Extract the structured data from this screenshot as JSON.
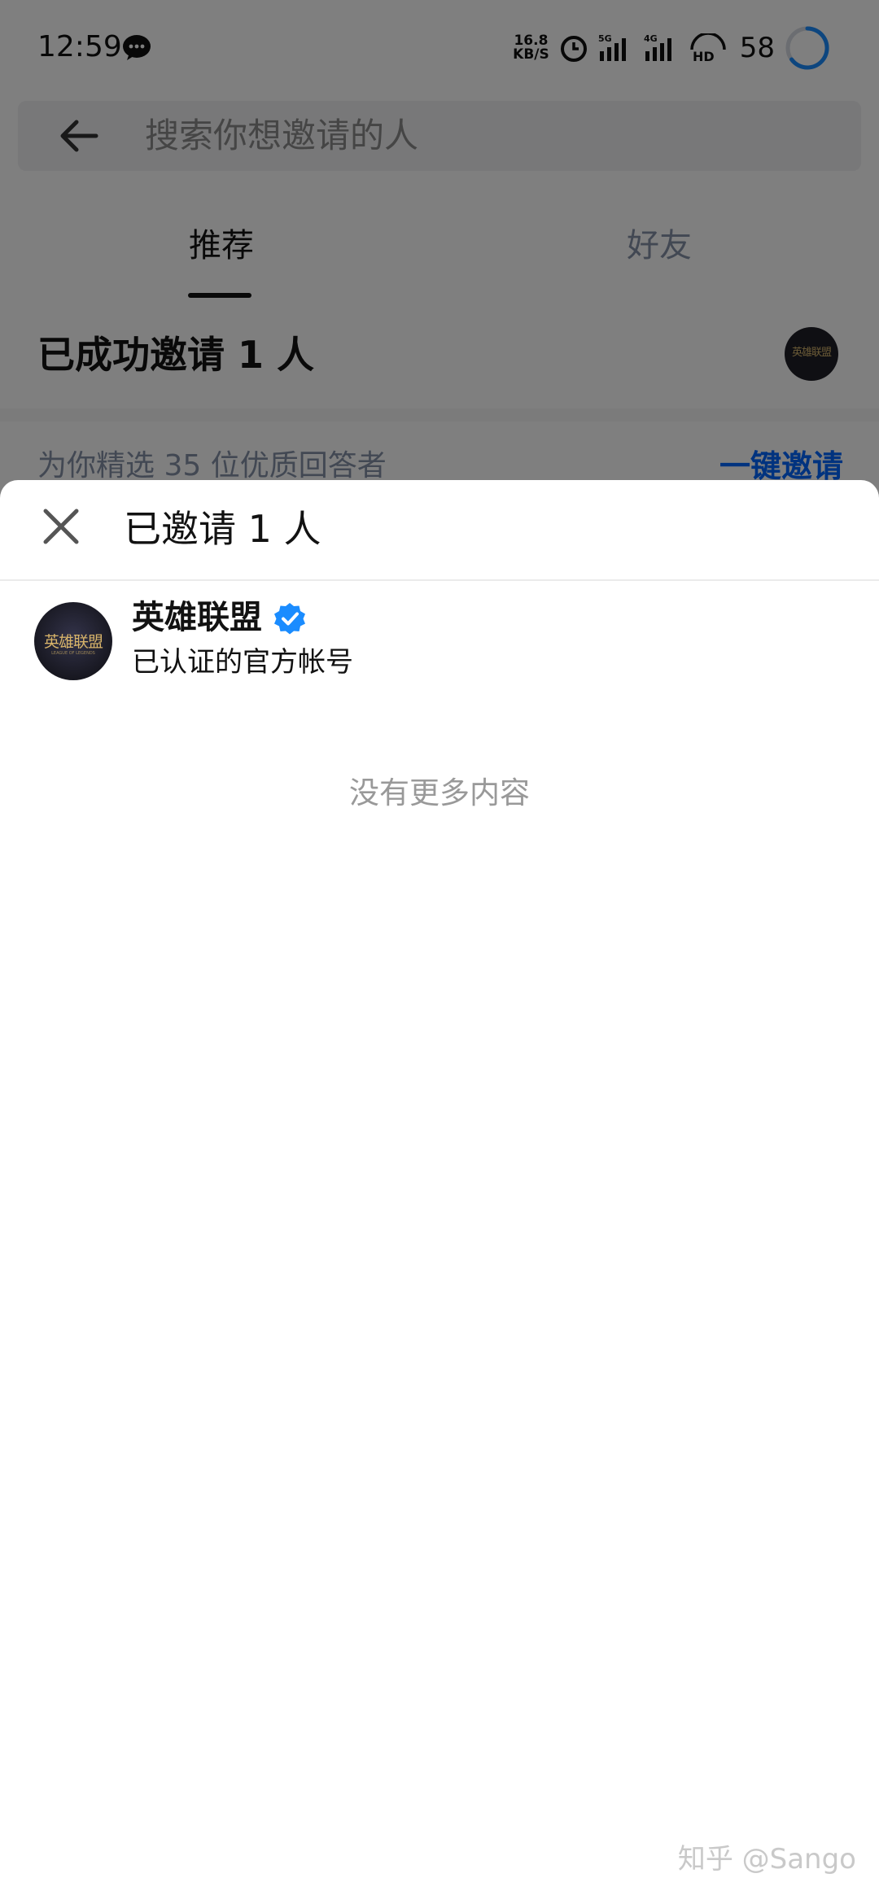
{
  "status_bar": {
    "time": "12:59",
    "net_speed_value": "16.8",
    "net_speed_unit": "KB/S",
    "signal_labels": [
      "5G",
      "4G"
    ],
    "battery": "58",
    "icons": [
      "chat-bubble-icon",
      "alarm-icon",
      "signal-icon",
      "hd-icon",
      "battery-ring-icon"
    ]
  },
  "search": {
    "placeholder": "搜索你想邀请的人"
  },
  "tabs": [
    {
      "label": "推荐",
      "active": true
    },
    {
      "label": "好友",
      "active": false
    }
  ],
  "invite_summary": "已成功邀请 1 人",
  "recommend": {
    "text": "为你精选 35 位优质回答者",
    "action": "一键邀请"
  },
  "sheet": {
    "title": "已邀请 1 人",
    "users": [
      {
        "name": "英雄联盟",
        "description": "已认证的官方帐号",
        "avatar_text": "英雄联盟",
        "avatar_subtext": "LEAGUE OF LEGENDS",
        "verified": true
      }
    ],
    "empty_text": "没有更多内容"
  },
  "watermark": "知乎 @Sango",
  "colors": {
    "accent": "#0066ff",
    "verified": "#1a8cff",
    "overlay": "rgba(0,0,0,0.5)",
    "muted": "#8590a6"
  }
}
